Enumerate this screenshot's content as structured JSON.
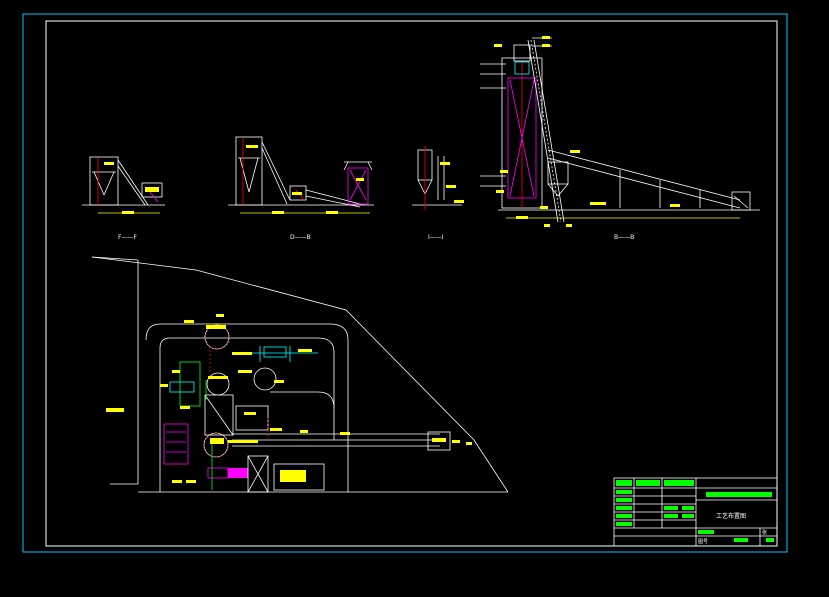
{
  "drawing": {
    "colors": {
      "background": "#000000",
      "outer_frame": "#00c8ff",
      "inner_frame": "#ffffff",
      "dimension": "#ffff00",
      "structure": "#ffffff",
      "equipment": "#ff00ff",
      "pipe": "#00ffff",
      "marker": "#ff0000",
      "grid": "#00ff00"
    },
    "views": [
      {
        "id": "view-1",
        "label": "F——F"
      },
      {
        "id": "view-2",
        "label": "D——B"
      },
      {
        "id": "view-3",
        "label": "I——I"
      },
      {
        "id": "view-4",
        "label": "B——B"
      }
    ],
    "title_block": {
      "drawing_title": "工艺布置图",
      "drawing_no_label": "图号",
      "sheet_label": "张"
    }
  }
}
